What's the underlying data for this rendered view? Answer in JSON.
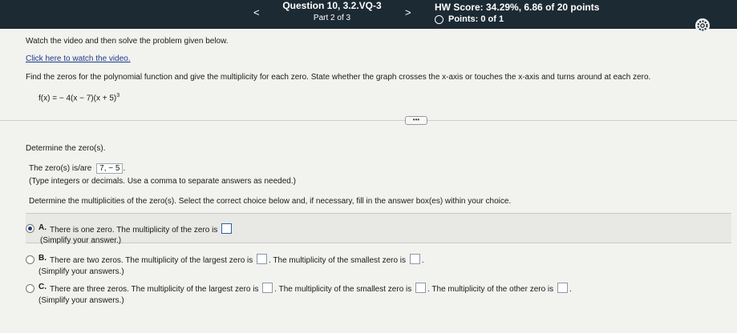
{
  "header": {
    "title": "Question 10, 3.2.VQ-3",
    "part": "Part 2 of 3",
    "prev_icon": "<",
    "next_icon": ">",
    "score": "HW Score: 34.29%, 6.86 of 20 points",
    "points": "Points: 0 of 1"
  },
  "content": {
    "instruction": "Watch the video and then solve the problem given below.",
    "video_link": "Click here to watch the video.",
    "problem": "Find the zeros for the polynomial function and give the multiplicity for each zero. State whether the graph crosses the x-axis or touches the x-axis and turns around at each zero.",
    "formula_left": "f(x) = − 4(x − 7)(x + 5)",
    "formula_exp": "3",
    "more_label": "•••",
    "determine_zeros": "Determine the zero(s).",
    "zeros_label": "The zero(s) is/are",
    "zeros_value": "7, − 5",
    "zeros_end": ".",
    "type_hint": "(Type integers or decimals. Use a comma to separate answers as needed.)",
    "determine_mult": "Determine the multiplicities of the zero(s). Select the correct choice below and, if necessary, fill in the answer box(es) within your choice."
  },
  "choices": {
    "a": {
      "letter": "A.",
      "text": "There is one zero. The multiplicity of the zero is",
      "hint": "(Simplify your answer.)"
    },
    "b": {
      "letter": "B.",
      "text1": "There are two zeros. The multiplicity of the largest zero is",
      "text2": ". The multiplicity of the smallest zero is",
      "end": ".",
      "hint": "(Simplify your answers.)"
    },
    "c": {
      "letter": "C.",
      "text1": "There are three zeros. The multiplicity of the largest zero is",
      "text2": ". The multiplicity of the smallest zero is",
      "text3": ". The multiplicity of the other zero is",
      "end": ".",
      "hint": "(Simplify your answers.)"
    }
  },
  "colors": {
    "header_bg": "#1c2a33",
    "link": "#1f3b8a",
    "radio_selected": "#1c3f6e"
  }
}
